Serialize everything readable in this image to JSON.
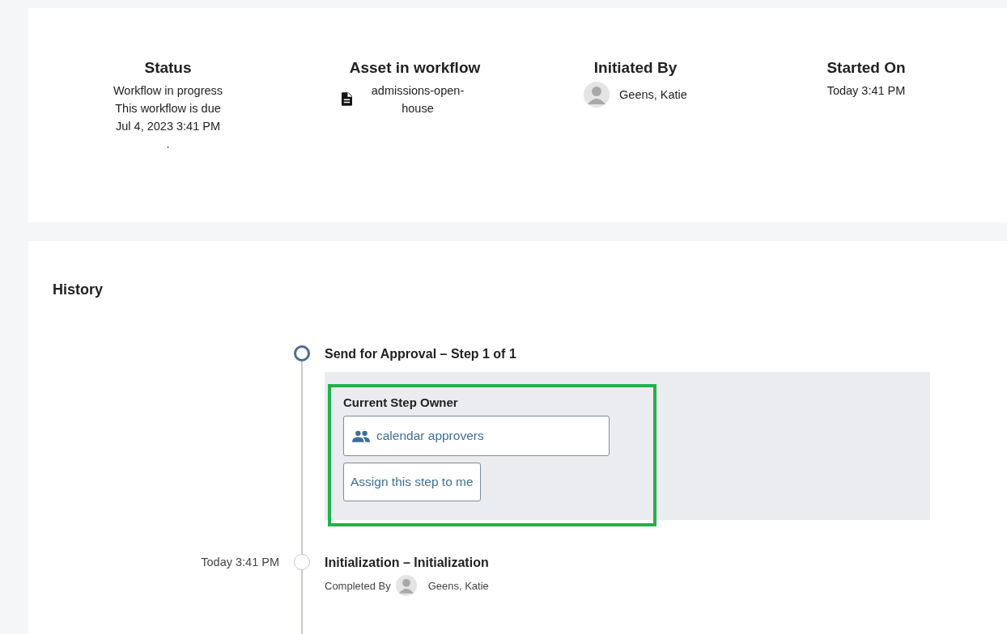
{
  "summary": [
    {
      "kind": "text",
      "heading": "Status",
      "lines": [
        "Workflow in progress",
        "This workflow is due",
        "Jul 4, 2023 3:41 PM",
        "."
      ]
    },
    {
      "kind": "asset",
      "heading": "Asset in workflow",
      "lines": [
        "admissions-open-",
        "house"
      ]
    },
    {
      "kind": "user",
      "heading": "Initiated By",
      "lines": [
        "Geens, Katie"
      ]
    },
    {
      "kind": "text",
      "heading": "Started On",
      "lines": [
        "Today 3:41 PM"
      ]
    }
  ],
  "history": {
    "title": "History",
    "steps": [
      {
        "current": true,
        "title": "Send for Approval – Step 1 of 1",
        "owner": {
          "label": "Current Step Owner",
          "group": "calendar approvers",
          "button": "Assign this step to me",
          "highlighted": true
        }
      },
      {
        "current": false,
        "time": "Today 3:41 PM",
        "title": "Initialization – Initialization",
        "completed_label": "Completed By",
        "completed_by": "Geens, Katie"
      }
    ]
  }
}
